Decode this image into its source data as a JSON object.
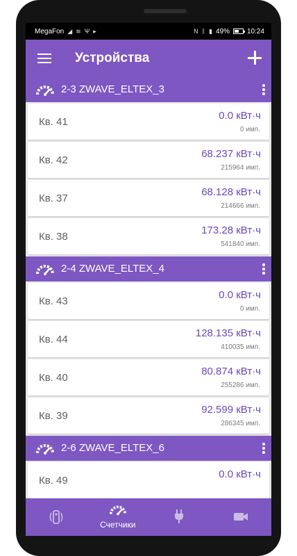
{
  "status_bar": {
    "carrier": "MegaFon",
    "left_icons": [
      "signal-icon",
      "wifi-icon",
      "usb-icon",
      "flag-icon"
    ],
    "right_icons": [
      "nfc-icon",
      "bluetooth-icon",
      "signal-bars-icon"
    ],
    "battery": "49%",
    "time": "10:24"
  },
  "appbar": {
    "title": "Устройства"
  },
  "groups": [
    {
      "title": "2-3 ZWAVE_ELTEX_3",
      "items": [
        {
          "name": "Кв. 41",
          "value": "0.0 кВт·ч",
          "count": "0 имп."
        },
        {
          "name": "Кв. 42",
          "value": "68.237 кВт·ч",
          "count": "215964 имп."
        },
        {
          "name": "Кв. 37",
          "value": "68.128 кВт·ч",
          "count": "214666 имп."
        },
        {
          "name": "Кв. 38",
          "value": "173.28 кВт·ч",
          "count": "541840 имп."
        }
      ]
    },
    {
      "title": "2-4 ZWAVE_ELTEX_4",
      "items": [
        {
          "name": "Кв. 43",
          "value": "0.0 кВт·ч",
          "count": "0 имп."
        },
        {
          "name": "Кв. 44",
          "value": "128.135 кВт·ч",
          "count": "410035 имп."
        },
        {
          "name": "Кв. 40",
          "value": "80.874 кВт·ч",
          "count": "255286 имп."
        },
        {
          "name": "Кв. 39",
          "value": "92.599 кВт·ч",
          "count": "286345 имп."
        }
      ]
    },
    {
      "title": "2-6 ZWAVE_ELTEX_6",
      "items": [
        {
          "name": "Кв. 49",
          "value": "0.0 кВт·ч",
          "count": ""
        }
      ]
    }
  ],
  "bottom_nav": {
    "items": [
      {
        "icon": "sensor-icon",
        "label": ""
      },
      {
        "icon": "meter-gauge-icon",
        "label": "Счетчики"
      },
      {
        "icon": "plug-icon",
        "label": ""
      },
      {
        "icon": "camera-icon",
        "label": ""
      }
    ],
    "active_index": 1
  },
  "colors": {
    "accent": "#7e57c2",
    "value_text": "#6a48b8",
    "background": "#ececec"
  }
}
